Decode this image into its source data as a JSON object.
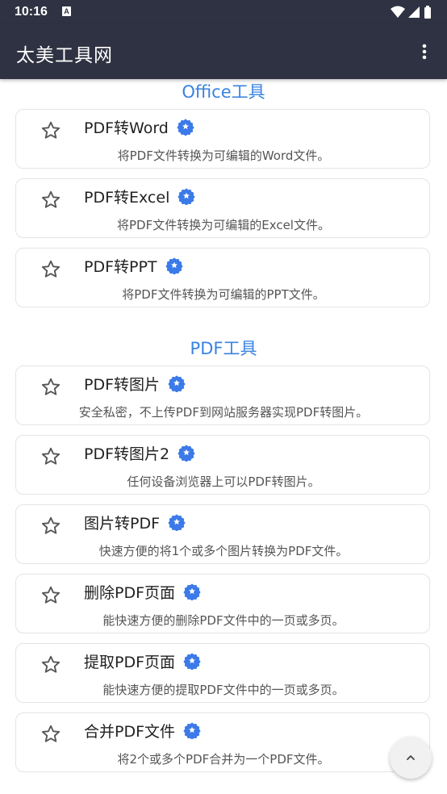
{
  "status": {
    "time": "10:16",
    "notif_glyph": "A"
  },
  "appbar": {
    "title": "太美工具网"
  },
  "sections": [
    {
      "title": "Office工具",
      "items": [
        {
          "name": "PDF转Word",
          "desc": "将PDF文件转换为可编辑的Word文件。"
        },
        {
          "name": "PDF转Excel",
          "desc": "将PDF文件转换为可编辑的Excel文件。"
        },
        {
          "name": "PDF转PPT",
          "desc": "将PDF文件转换为可编辑的PPT文件。"
        }
      ]
    },
    {
      "title": "PDF工具",
      "items": [
        {
          "name": "PDF转图片",
          "desc": "安全私密，不上传PDF到网站服务器实现PDF转图片。"
        },
        {
          "name": "PDF转图片2",
          "desc": "任何设备浏览器上可以PDF转图片。"
        },
        {
          "name": "图片转PDF",
          "desc": "快速方便的将1个或多个图片转换为PDF文件。"
        },
        {
          "name": "删除PDF页面",
          "desc": "能快速方便的删除PDF文件中的一页或多页。"
        },
        {
          "name": "提取PDF页面",
          "desc": "能快速方便的提取PDF文件中的一页或多页。"
        },
        {
          "name": "合并PDF文件",
          "desc": "将2个或多个PDF合并为一个PDF文件。"
        }
      ]
    }
  ],
  "colors": {
    "appbar": "#2f3242",
    "section_title": "#3a83e0",
    "badge": "#3b7ae8"
  },
  "icons": {
    "favorite": "star-outline-icon",
    "badge": "verified-badge-icon",
    "menu": "more-vert-icon",
    "scroll_top": "chevron-up-icon"
  }
}
